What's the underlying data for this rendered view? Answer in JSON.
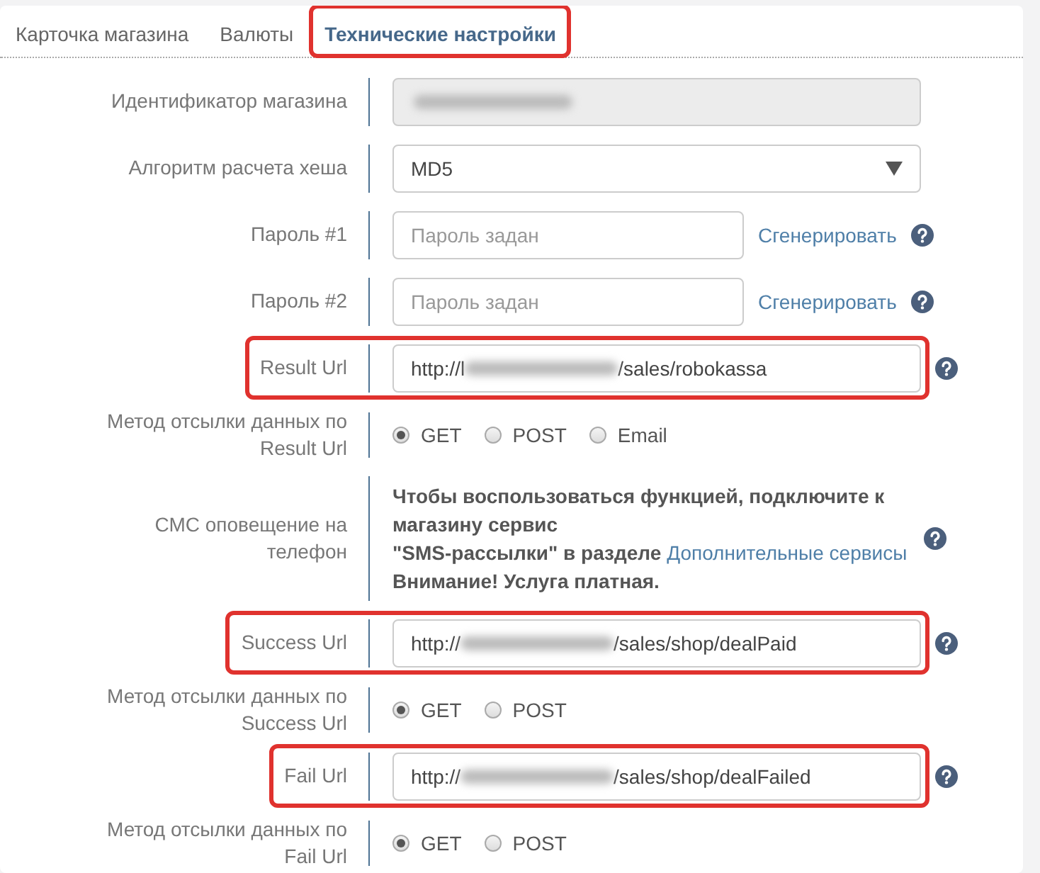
{
  "tabs": [
    {
      "label": "Карточка магазина",
      "selected": false,
      "highlighted": false
    },
    {
      "label": "Валюты",
      "selected": false,
      "highlighted": false
    },
    {
      "label": "Технические настройки",
      "selected": true,
      "highlighted": true
    }
  ],
  "rows": [
    {
      "kind": "field",
      "label": "Идентификатор магазина",
      "disabled": true,
      "redacted": true
    },
    {
      "kind": "select",
      "label": "Алгоритм расчета хеша",
      "value": "MD5"
    },
    {
      "kind": "password",
      "label": "Пароль #1",
      "placeholder": "Пароль задан",
      "link": "Сгенерировать",
      "help": true
    },
    {
      "kind": "password",
      "label": "Пароль #2",
      "placeholder": "Пароль задан",
      "link": "Сгенерировать",
      "help": true
    },
    {
      "kind": "url",
      "label": "Result Url",
      "value_start": "http://l",
      "value_end": "/sales/robokassa",
      "redacted": true,
      "help": true,
      "highlighted": true
    },
    {
      "kind": "radio",
      "label": "Метод отсылки данных по Result Url",
      "options": [
        {
          "label": "GET",
          "selected": true
        },
        {
          "label": "POST",
          "selected": false
        },
        {
          "label": "Email",
          "selected": false
        }
      ]
    },
    {
      "kind": "notice",
      "label": "СМС оповещение на телефон",
      "lines": [
        "Чтобы воспользоваться функцией, подключите к магазину сервис",
        "\"SMS-рассылки\" в разделе"
      ],
      "link": "Дополнительные сервисы",
      "after": "Внимание! Услуга платная.",
      "help": true
    },
    {
      "kind": "url",
      "label": "Success Url",
      "value_start": "http://",
      "value_end": "/sales/shop/dealPaid",
      "redacted": true,
      "help": true,
      "highlighted": true
    },
    {
      "kind": "radio",
      "label": "Метод отсылки данных по Success Url",
      "options": [
        {
          "label": "GET",
          "selected": true
        },
        {
          "label": "POST",
          "selected": false
        }
      ]
    },
    {
      "kind": "url",
      "label": "Fail Url",
      "value_start": "http://",
      "value_end": "/sales/shop/dealFailed",
      "redacted": true,
      "help": true,
      "highlighted": true
    },
    {
      "kind": "radio",
      "label": "Метод отсылки данных по Fail Url",
      "options": [
        {
          "label": "GET",
          "selected": true
        },
        {
          "label": "POST",
          "selected": false
        }
      ]
    }
  ]
}
